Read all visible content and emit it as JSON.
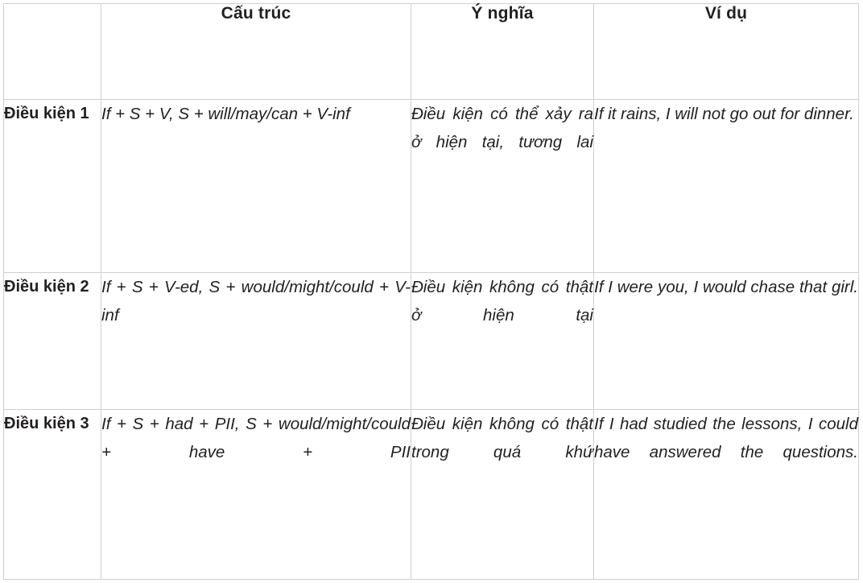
{
  "table": {
    "headers": [
      {
        "label": "",
        "name": "corner-blank"
      },
      {
        "label": "Cấu trúc",
        "name": "header-structure"
      },
      {
        "label": "Ý nghĩa",
        "name": "header-meaning"
      },
      {
        "label": "Ví dụ",
        "name": "header-example"
      }
    ],
    "rows": [
      {
        "label": "Điều kiện 1",
        "structure": "If + S + V, S + will/may/can + V-inf",
        "meaning": "Điều kiện có thể xảy ra ở hiện tại, tương lai",
        "example": "If it rains, I will not go out for dinner."
      },
      {
        "label": "Điều kiện 2",
        "structure": "If + S + V-ed, S + would/might/could + V-inf",
        "meaning": "Điều kiện không có thật ở hiện tại",
        "example": "If I were you, I would chase that girl."
      },
      {
        "label": "Điều kiện 3",
        "structure": "If + S + had + PII, S + would/might/could + have + PII",
        "meaning": "Điều kiện không có thật trong quá khứ",
        "example": "If I had studied the lessons, I could have answered the questions."
      }
    ]
  },
  "colors": {
    "border": "#cfcfcf",
    "text": "#231f20",
    "background": "#ffffff"
  }
}
